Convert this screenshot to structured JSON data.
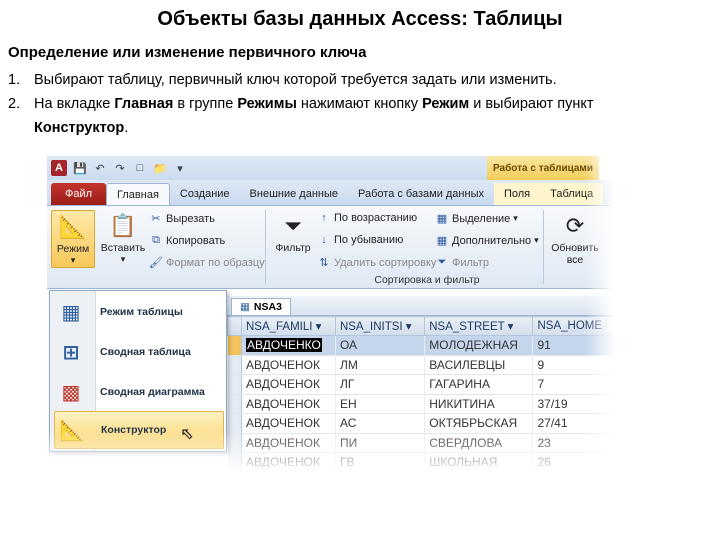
{
  "slide": {
    "title": "Объекты базы данных Access: Таблицы",
    "subtitle": "Определение или изменение первичного ключа",
    "step1_num": "1.",
    "step1_text": "Выбирают таблицу, первичный ключ которой требуется задать или изменить.",
    "step2_num": "2.",
    "step2_a": "На вкладке ",
    "step2_b": "Главная",
    "step2_c": " в группе ",
    "step2_d": "Режимы",
    "step2_e": " нажимают кнопку ",
    "step2_f": "Режим",
    "step2_g": " и выбирают пункт",
    "step2_h": "Конструктор",
    "step2_i": "."
  },
  "qat": {
    "app_icon": "A",
    "icons": [
      "save-icon",
      "undo-icon",
      "redo-icon",
      "new-icon",
      "open-icon",
      "dropdown-icon"
    ]
  },
  "ribbon_tabs": {
    "context_header": "Работа с таблицами",
    "file": "Файл",
    "home": "Главная",
    "create": "Создание",
    "external": "Внешние данные",
    "dbtools": "Работа с базами данных",
    "fields": "Поля",
    "table": "Таблица"
  },
  "ribbon": {
    "view": "Режим",
    "paste": "Вставить",
    "cut": "Вырезать",
    "copy": "Копировать",
    "format_painter": "Формат по образцу",
    "filter": "Фильтр",
    "ascending": "По возрастанию",
    "descending": "По убыванию",
    "remove_sort": "Удалить сортировку",
    "selection": "Выделение",
    "advanced": "Дополнительно",
    "toggle_filter": "Фильтр",
    "sort_filter_group": "Сортировка и фильтр",
    "refresh": "Обновить",
    "refresh2": "все"
  },
  "view_menu": {
    "datasheet": "Режим таблицы",
    "pivot_table": "Сводная таблица",
    "pivot_chart": "Сводная диаграмма",
    "design": "Конструктор"
  },
  "table": {
    "name": "NSA3",
    "columns": [
      "NSA_FAMILI",
      "NSA_INITSI",
      "NSA_STREET",
      "NSA_HOME"
    ],
    "rows": [
      [
        "АВДОЧЕНКО",
        "ОА",
        "МОЛОДЕЖНАЯ",
        "91"
      ],
      [
        "АВДОЧЕНОК",
        "ЛМ",
        "ВАСИЛЕВЦЫ",
        "9"
      ],
      [
        "АВДОЧЕНОК",
        "ЛГ",
        "ГАГАРИНА",
        "7"
      ],
      [
        "АВДОЧЕНОК",
        "ЕН",
        "НИКИТИНА",
        "37/19"
      ],
      [
        "АВДОЧЕНОК",
        "АС",
        "ОКТЯБРЬСКАЯ",
        "27/41"
      ],
      [
        "АВДОЧЕНОК",
        "ПИ",
        "СВЕРДЛОВА",
        "23"
      ],
      [
        "АВДОЧЕНОК",
        "ГВ",
        "ШКОЛЬНАЯ",
        "26"
      ]
    ]
  }
}
